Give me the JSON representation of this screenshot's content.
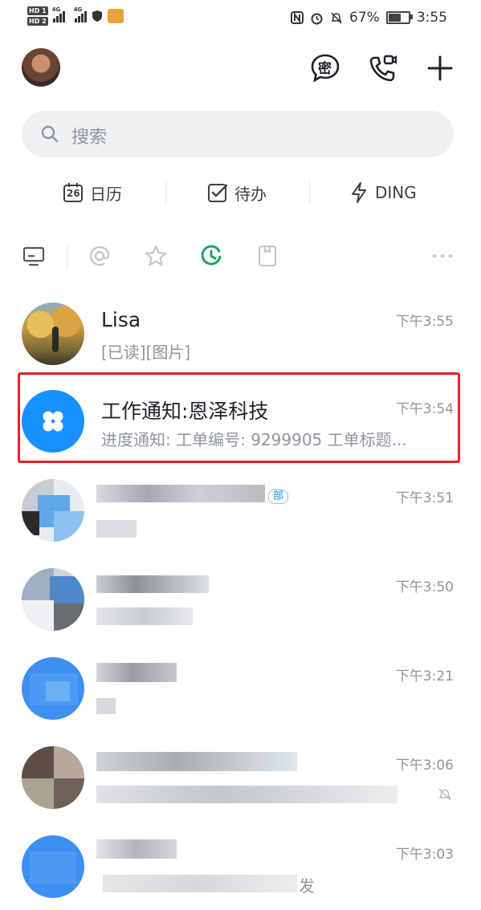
{
  "status_bar": {
    "hd_tags": [
      "HD 1",
      "HD 2"
    ],
    "network": [
      "4G",
      "4G"
    ],
    "battery_percent_text": "67%",
    "battery_level": 0.67,
    "time": "3:55"
  },
  "header": {
    "icons": [
      "avatar",
      "secret-chat-icon",
      "video-call-icon",
      "add-icon"
    ],
    "secret_glyph": "密"
  },
  "search": {
    "placeholder": "搜索"
  },
  "quick_actions": {
    "calendar_label": "日历",
    "calendar_day": "26",
    "todo_label": "待办",
    "ding_label": "DING"
  },
  "filters": [
    "desktop-icon",
    "mention-icon",
    "star-icon",
    "recent-icon",
    "document-icon",
    "more-icon"
  ],
  "conversations": [
    {
      "name": "Lisa",
      "preview": "[已读][图片]",
      "time": "下午3:55",
      "avatar": "photo"
    },
    {
      "name": "工作通知:恩泽科技",
      "preview": "进度通知: 工单编号: 9299905 工单标题...",
      "time": "下午3:54",
      "avatar": "app"
    },
    {
      "name": "",
      "preview": "",
      "time": "下午3:51",
      "badge": "部",
      "avatar": "blurred"
    },
    {
      "name": "",
      "preview": "",
      "time": "下午3:50",
      "avatar": "blurred"
    },
    {
      "name": "",
      "preview": "",
      "time": "下午3:21",
      "avatar": "blurred"
    },
    {
      "name": "",
      "preview": "",
      "time": "下午3:06",
      "avatar": "blurred",
      "muted": true
    },
    {
      "name": "",
      "preview": "发",
      "time": "下午3:03",
      "avatar": "blurred"
    }
  ],
  "colors": {
    "accent": "#1890ff",
    "highlight": "#e52222",
    "recent_active": "#1aa563"
  }
}
